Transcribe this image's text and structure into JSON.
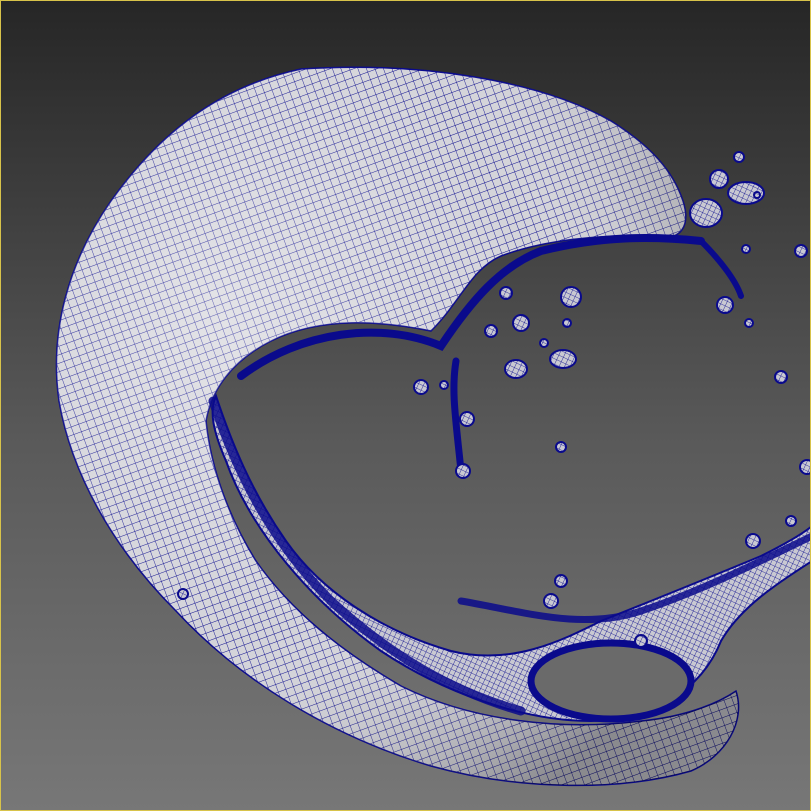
{
  "viewport": {
    "kind": "3d-viewport",
    "render_style": "wireframe-on-shaded",
    "wire_color": "#0a0a8c",
    "surface_color": "#d6d6dc",
    "background_top": "#262626",
    "background_bottom": "#777777",
    "frame_color": "#d8c34a"
  },
  "scene": {
    "object": "fluid-splash-mesh",
    "icon": "mesh-icon"
  }
}
